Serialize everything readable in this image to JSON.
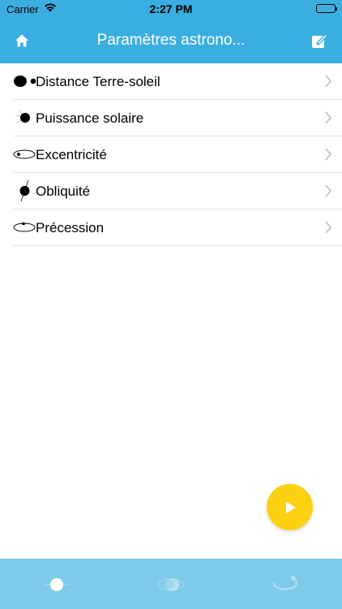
{
  "status_bar": {
    "carrier": "Carrier",
    "time": "2:27 PM",
    "wifi_icon": "wifi-icon",
    "battery_icon": "battery-icon"
  },
  "nav": {
    "title": "Paramètres astrono...",
    "home_icon": "home-icon",
    "edit_icon": "edit-icon",
    "bar_color": "#3aaee0"
  },
  "list": {
    "items": [
      {
        "label": "Distance Terre-soleil",
        "icon": "earth-sun-distance-icon"
      },
      {
        "label": "Puissance solaire",
        "icon": "solar-power-icon"
      },
      {
        "label": "Excentricité",
        "icon": "eccentricity-icon"
      },
      {
        "label": "Obliquité",
        "icon": "obliquity-icon"
      },
      {
        "label": "Précession",
        "icon": "precession-icon"
      }
    ]
  },
  "fab": {
    "icon": "play-icon",
    "color": "#fcd112"
  },
  "tab_bar": {
    "color": "#7ecbe9",
    "tabs": [
      {
        "icon": "sun-tab-icon",
        "selected": true
      },
      {
        "icon": "orbit-tab-icon",
        "selected": false
      },
      {
        "icon": "rotation-tab-icon",
        "selected": false
      }
    ]
  }
}
